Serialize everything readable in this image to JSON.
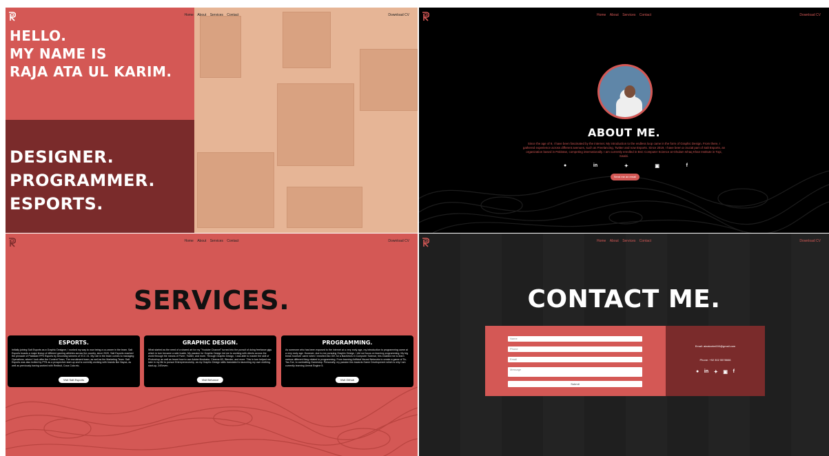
{
  "nav": {
    "links": [
      "Home",
      "About",
      "Services",
      "Contact"
    ],
    "download": "Download CV"
  },
  "hero": {
    "greeting_lines": [
      "HELLO.",
      "MY NAME IS",
      "RAJA ATA UL KARIM."
    ],
    "roles": [
      "DESIGNER.",
      "PROGRAMMER.",
      "ESPORTS."
    ]
  },
  "about": {
    "title": "ABOUT ME.",
    "text": "Since the age of 9, I have been fascinated by the internet. My introduction to the endless loop came in the form of Graphic Design. From there, I gathered experience across different avenues, such as Freelancing, Twitter and now Esports. Since 2019, I have been a crucial part of Salt Esports, an organization based in Pakistan, competing internationally. I am currently enrolled in BsC Computer Science at Ghulam Ishaq Khan Institute in Topi, Swabi.",
    "socials": [
      "github",
      "in",
      "twitter",
      "instagram",
      "f"
    ],
    "email_button": "Send me an email"
  },
  "services": {
    "title": "SERVICES.",
    "cards": [
      {
        "heading": "ESPORTS.",
        "body": "Initially joining Salt Esports as a Graphic Designer, I worked my way to now being a co-owner in the team. Salt Esports boasts a major lineup of different gaming athletes across the country, since 2020, Salt Esports reached the pinnacle of Pakistani FPS Esports by becoming winners of VCC 21. My role in the team comes to managing Operations, where I look after the Content Team, The recruitment team, as well as the Marketing Team. Salt Esports was also invited by PTB as a prospective start-up and is currently working with brands like Nayza, as well as previously having worked with Redbull, Coca Cola etc.",
        "button": "Visit Salt Esports"
      },
      {
        "heading": "GRAPHIC DESIGN.",
        "body": "What started as the need of a shared art for my \"Youtube Channel\" turned into the pursuit of doing freelance gigs which in turn became a side hustle. My passion for Graphic Design led me to working with clients across the world through the means of Fiverr, Twitter, and more. Through Graphic Design, I was able to master the skill of Photoshop as well as learnt how to use Adobe Illustrator, Cinema 4D, Blender, and more. This in turn helped me later in my life to pursue Entrepreneurship, as my Graphic Design skills translated to launching my own clothing start-up, 24Seven.",
        "button": "Visit Behance"
      },
      {
        "heading": "PROGRAMMING.",
        "body": "As someone who has been exposed to the internet at a very early age, my introduction to programming came at a very early age. However, due to me pursuing Graphic Design, I did not focus on learning programming. My big break however came when I enrolled into GIK for a Bachelors in Computer Science, this enabled me to learn various different thing related to programming. From learning Artificial Neural Networks to create a game of Tic-Tac-Toe, to combatting Gamestop. Personally, my passion lies towards Game Development which is why I am currently learning Unreal Engine 5.",
        "button": "Visit Github"
      }
    ]
  },
  "contact": {
    "title": "CONTACT ME.",
    "fields": [
      {
        "placeholder": "Name"
      },
      {
        "placeholder": "Phone"
      },
      {
        "placeholder": "Email"
      },
      {
        "placeholder": "Message"
      }
    ],
    "submit": "Submit",
    "email": "Email: atzakarim000@gmail.com",
    "phone": "Phone: +92 302 5578666",
    "socials": [
      "github",
      "in",
      "twitter",
      "instagram",
      "f"
    ]
  },
  "colors": {
    "accent": "#d45855",
    "dark_red": "#7a2b2b",
    "peach": "#e9b797",
    "black": "#000000"
  }
}
